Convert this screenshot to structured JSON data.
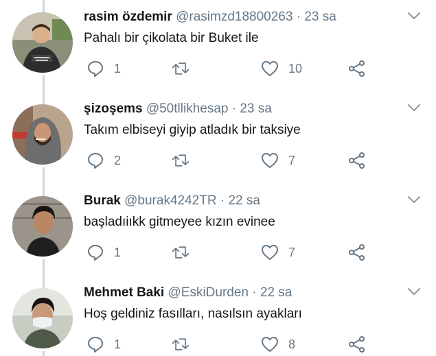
{
  "colors": {
    "text": "#14171a",
    "secondary": "#657786",
    "thread_line": "#ccd6dd"
  },
  "icons": {
    "reply": "reply-icon",
    "retweet": "retweet-icon",
    "like": "like-icon",
    "share": "share-icon",
    "more": "chevron-down-icon"
  },
  "tweets": [
    {
      "display_name": "rasim özdemir",
      "handle": "@rasimzd18800263",
      "separator": "·",
      "time": "23 sa",
      "text": "Pahalı bir çikolata bir Buket ile",
      "replies": "1",
      "likes": "10"
    },
    {
      "display_name": "şizoşems",
      "handle": "@50tllikhesap",
      "separator": "·",
      "time": "23 sa",
      "text": "Takım elbiseyi giyip atladık bir taksiye",
      "replies": "2",
      "likes": "7"
    },
    {
      "display_name": "Burak",
      "handle": "@burak4242TR",
      "separator": "·",
      "time": "22 sa",
      "text": "başladıiıkk gitmeyee kızın evinee",
      "replies": "1",
      "likes": "7"
    },
    {
      "display_name": "Mehmet Baki",
      "handle": "@EskiDurden",
      "separator": "·",
      "time": "22 sa",
      "text": "Hoş geldiniz fasılları, nasılsın ayakları",
      "replies": "1",
      "likes": "8"
    }
  ]
}
